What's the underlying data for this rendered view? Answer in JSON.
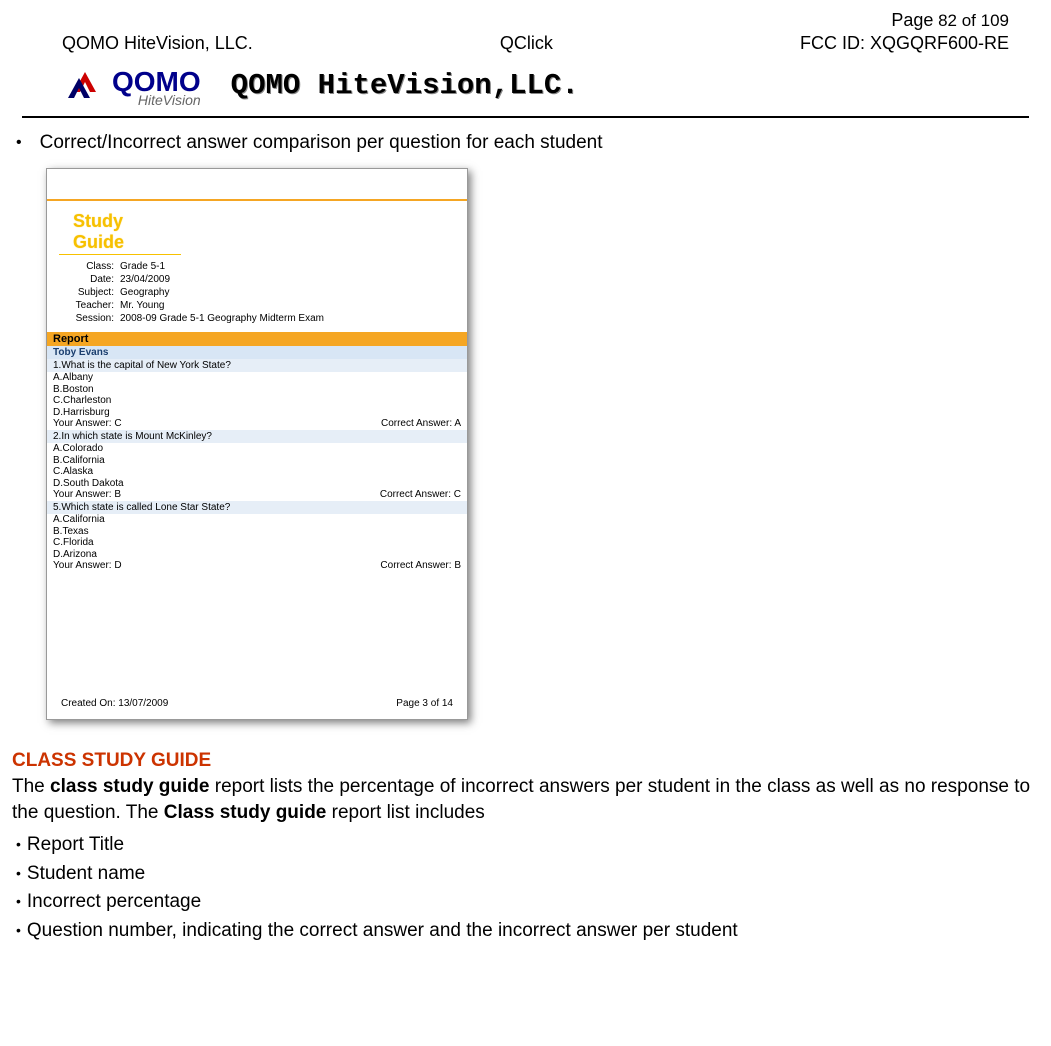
{
  "header": {
    "page_label": "Page",
    "page_number": "82 of 109",
    "left": "QOMO HiteVision, LLC.",
    "center": "QClick",
    "right": "FCC ID: XQGQRF600-RE",
    "logo_main": "QOMO",
    "logo_sub": "HiteVision",
    "logo_title": "QOMO HiteVision,LLC."
  },
  "bullet_main": "Correct/Incorrect answer comparison per question for each student",
  "screenshot": {
    "title": "Study Guide",
    "meta": {
      "class_label": "Class:",
      "class_value": "Grade 5-1",
      "date_label": "Date:",
      "date_value": "23/04/2009",
      "subject_label": "Subject:",
      "subject_value": "Geography",
      "teacher_label": "Teacher:",
      "teacher_value": "Mr. Young",
      "session_label": "Session:",
      "session_value": "2008-09 Grade 5-1 Geography Midterm Exam"
    },
    "report_header": "Report",
    "student": "Toby Evans",
    "questions": [
      {
        "q": "1.What is the capital of New York State?",
        "opts": [
          "A.Albany",
          "B.Boston",
          "C.Charleston",
          "D.Harrisburg"
        ],
        "your_label": "Your Answer: C",
        "correct_label": "Correct Answer: A"
      },
      {
        "q": "2.In which state is Mount McKinley?",
        "opts": [
          "A.Colorado",
          "B.California",
          "C.Alaska",
          "D.South Dakota"
        ],
        "your_label": "Your Answer: B",
        "correct_label": "Correct Answer: C"
      },
      {
        "q": "5.Which state is called Lone Star State?",
        "opts": [
          "A.California",
          "B.Texas",
          "C.Florida",
          "D.Arizona"
        ],
        "your_label": "Your Answer: D",
        "correct_label": "Correct Answer: B"
      }
    ],
    "footer_left": "Created On: 13/07/2009",
    "footer_right": "Page 3 of 14"
  },
  "section": {
    "heading": "CLASS STUDY GUIDE",
    "para_pre": "The ",
    "para_bold1": "class study guide",
    "para_mid": " report lists the percentage of incorrect answers per student in the class as well as no response to the question.    The ",
    "para_bold2": "Class study guide",
    "para_post": " report list includes",
    "bullets": [
      "Report Title",
      "Student name",
      "Incorrect percentage",
      "Question number, indicating the correct answer and the incorrect answer per student"
    ]
  }
}
